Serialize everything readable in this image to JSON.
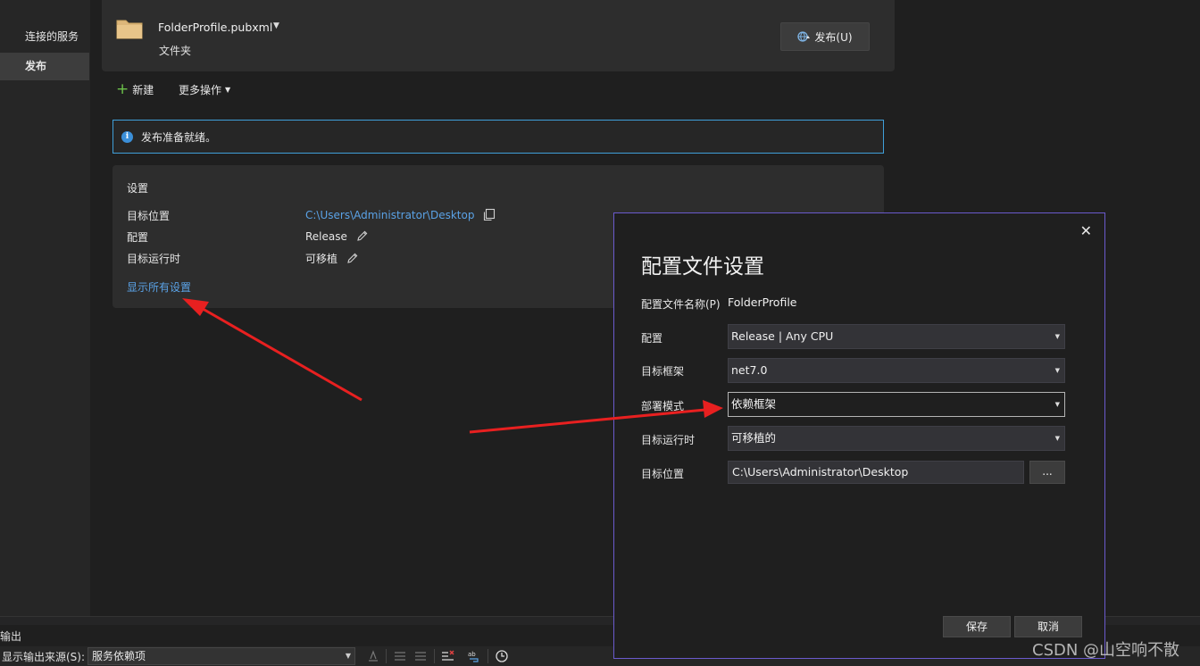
{
  "sidenav": {
    "items": [
      {
        "label": "连接的服务",
        "active": false
      },
      {
        "label": "发布",
        "active": true
      }
    ]
  },
  "profile": {
    "name": "FolderProfile.pubxml",
    "type": "文件夹",
    "publish_label": "发布(U)"
  },
  "toolbar": {
    "new_label": "新建",
    "more_label": "更多操作"
  },
  "info": {
    "message": "发布准备就绪。"
  },
  "settings": {
    "title": "设置",
    "rows": [
      {
        "label": "目标位置",
        "value": "C:\\Users\\Administrator\\Desktop"
      },
      {
        "label": "配置",
        "value": "Release"
      },
      {
        "label": "目标运行时",
        "value": "可移植"
      }
    ],
    "show_all_label": "显示所有设置"
  },
  "dialog": {
    "title": "配置文件设置",
    "close_glyph": "✕",
    "profile_name_label": "配置文件名称(P)",
    "profile_name_value": "FolderProfile",
    "fields": [
      {
        "label": "配置",
        "value": "Release | Any CPU"
      },
      {
        "label": "目标框架",
        "value": "net7.0"
      },
      {
        "label": "部署模式",
        "value": "依赖框架"
      },
      {
        "label": "目标运行时",
        "value": "可移植的"
      }
    ],
    "target_location_label": "目标位置",
    "target_location_value": "C:\\Users\\Administrator\\Desktop",
    "browse_label": "...",
    "save_label": "保存",
    "cancel_label": "取消"
  },
  "output": {
    "title": "输出",
    "source_label": "显示输出来源(S):",
    "source_value": "服务依赖项"
  },
  "watermark": "CSDN @山空响不散",
  "colors": {
    "accent": "#3f9fd9",
    "link": "#5aa2e6",
    "dialog_border": "#6a5acd",
    "annotation_arrow": "#e82020"
  }
}
